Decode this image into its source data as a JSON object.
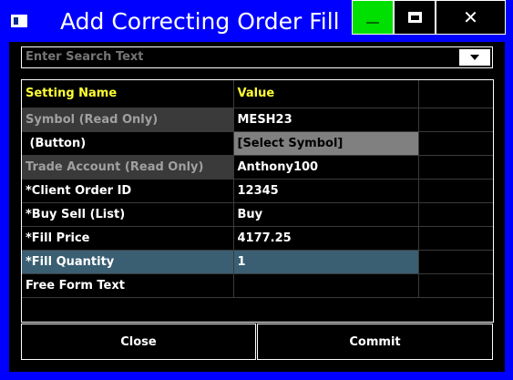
{
  "window": {
    "title": "Add Correcting Order Fill",
    "controls": {
      "minimize": "—",
      "close": "✕"
    }
  },
  "search": {
    "placeholder": "Enter Search Text",
    "value": ""
  },
  "grid": {
    "headers": [
      "Setting Name",
      "Value",
      ""
    ],
    "rows": [
      {
        "name": "Symbol (Read Only)",
        "value": "MESH23",
        "extra": ""
      },
      {
        "name": " (Button)",
        "value": "[Select Symbol]",
        "extra": ""
      },
      {
        "name": "Trade Account (Read Only)",
        "value": "Anthony100",
        "extra": ""
      },
      {
        "name": "*Client Order ID",
        "value": "12345",
        "extra": ""
      },
      {
        "name": "*Buy Sell (List)",
        "value": "Buy",
        "extra": ""
      },
      {
        "name": "*Fill Price",
        "value": "4177.25",
        "extra": ""
      },
      {
        "name": "*Fill Quantity",
        "value": "1",
        "extra": ""
      },
      {
        "name": "Free Form Text",
        "value": "",
        "extra": ""
      }
    ]
  },
  "buttons": {
    "close": "Close",
    "commit": "Commit"
  },
  "colors": {
    "titlebar": "#0000ff",
    "header_text": "#ffff33",
    "minimize_bg": "#00e000",
    "read_only_bg": "#3a3a3a",
    "button_value_bg": "#808080",
    "selected_row_bg": "#3a5f73"
  }
}
